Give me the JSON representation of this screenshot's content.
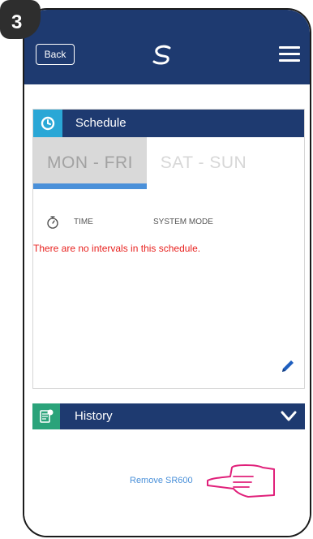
{
  "step_number": "3",
  "header": {
    "back_label": "Back"
  },
  "schedule": {
    "title": "Schedule",
    "tabs": [
      {
        "label": "MON - FRI",
        "active": true
      },
      {
        "label": "SAT - SUN",
        "active": false
      }
    ],
    "columns": {
      "time": "TIME",
      "system_mode": "SYSTEM MODE"
    },
    "empty_message": "There are no intervals in this schedule."
  },
  "history": {
    "title": "History"
  },
  "actions": {
    "remove_label": "Remove SR600"
  },
  "colors": {
    "header_bg": "#1e3a70",
    "schedule_icon_bg": "#2aa7d6",
    "history_icon_bg": "#2aa37a",
    "empty_message": "#e8221f",
    "link": "#4a90d9",
    "pointer": "#e0207a"
  },
  "icons": {
    "logo": "salus-logo-icon",
    "menu": "hamburger-menu-icon",
    "schedule": "schedule-clock-icon",
    "stopwatch": "stopwatch-icon",
    "edit": "pencil-edit-icon",
    "history": "history-document-icon",
    "expand": "chevron-down-icon",
    "pointer": "pointing-hand-icon"
  }
}
